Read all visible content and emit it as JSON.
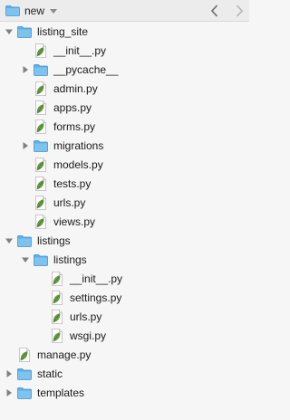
{
  "toolbar": {
    "path_label": "new",
    "folder_icon": "folder-icon",
    "dropdown_icon": "chevron-down-icon",
    "back_icon": "chevron-left-icon",
    "forward_icon": "chevron-right-icon"
  },
  "colors": {
    "folder": "#5ab0e8",
    "folder_tab": "#4aa3dc",
    "py_leaf": "#6aa341",
    "text": "#1a1a1a"
  },
  "tree": [
    {
      "label": "listing_site",
      "kind": "folder",
      "expanded": true,
      "depth": 0
    },
    {
      "label": "__init__.py",
      "kind": "file",
      "depth": 1
    },
    {
      "label": "__pycache__",
      "kind": "folder",
      "expanded": false,
      "depth": 1
    },
    {
      "label": "admin.py",
      "kind": "file",
      "depth": 1
    },
    {
      "label": "apps.py",
      "kind": "file",
      "depth": 1
    },
    {
      "label": "forms.py",
      "kind": "file",
      "depth": 1
    },
    {
      "label": "migrations",
      "kind": "folder",
      "expanded": false,
      "depth": 1
    },
    {
      "label": "models.py",
      "kind": "file",
      "depth": 1
    },
    {
      "label": "tests.py",
      "kind": "file",
      "depth": 1
    },
    {
      "label": "urls.py",
      "kind": "file",
      "depth": 1
    },
    {
      "label": "views.py",
      "kind": "file",
      "depth": 1
    },
    {
      "label": "listings",
      "kind": "folder",
      "expanded": true,
      "depth": 0
    },
    {
      "label": "listings",
      "kind": "folder",
      "expanded": true,
      "depth": 1
    },
    {
      "label": "__init__.py",
      "kind": "file",
      "depth": 2
    },
    {
      "label": "settings.py",
      "kind": "file",
      "depth": 2
    },
    {
      "label": "urls.py",
      "kind": "file",
      "depth": 2
    },
    {
      "label": "wsgi.py",
      "kind": "file",
      "depth": 2
    },
    {
      "label": "manage.py",
      "kind": "file",
      "depth": 0
    },
    {
      "label": "static",
      "kind": "folder",
      "expanded": false,
      "depth": 0
    },
    {
      "label": "templates",
      "kind": "folder",
      "expanded": false,
      "depth": 0
    }
  ]
}
